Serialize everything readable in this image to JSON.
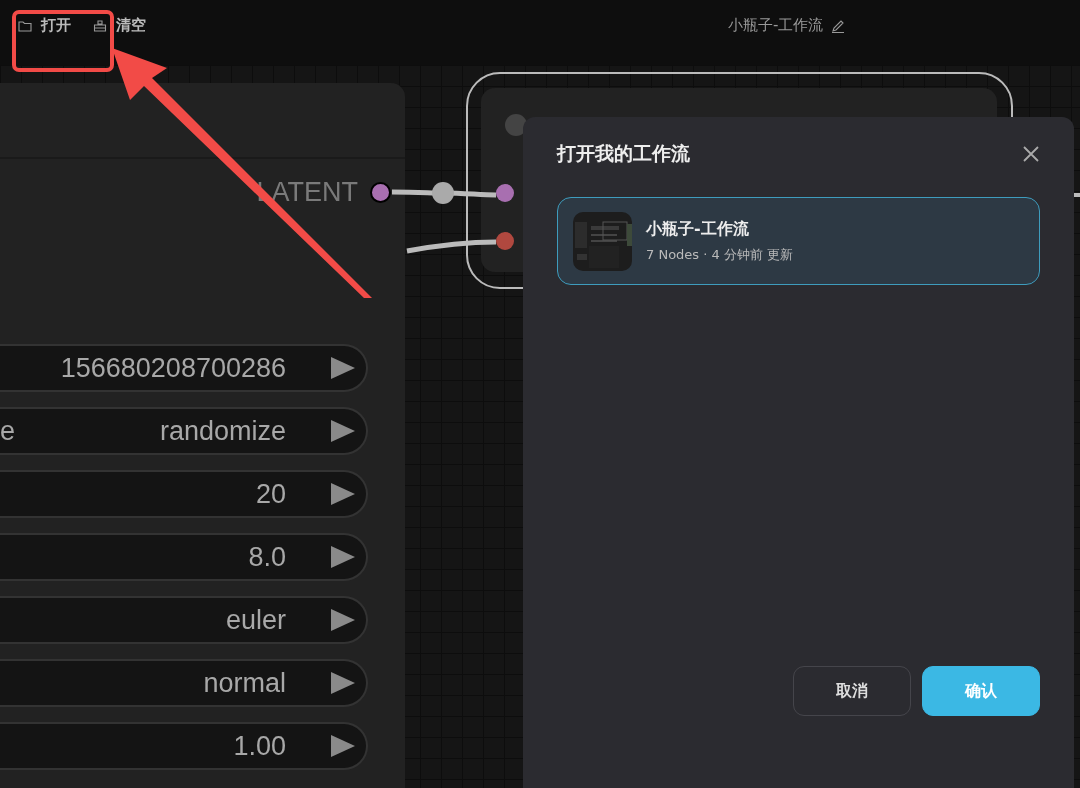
{
  "toolbar": {
    "buttons": [
      {
        "kind": "open",
        "label": "打开"
      },
      {
        "kind": "clear",
        "label": "清空"
      }
    ],
    "workflow_title": "小瓶子-工作流"
  },
  "sampler_node": {
    "output": "LATENT",
    "widgets": [
      {
        "value": "156680208700286"
      },
      {
        "label": "e",
        "value": "randomize"
      },
      {
        "value": "20"
      },
      {
        "value": "8.0"
      },
      {
        "value": "euler"
      },
      {
        "value": "normal"
      },
      {
        "value": "1.00"
      }
    ]
  },
  "decode_node": {
    "inputs": [
      {
        "color": "#a86fb0"
      },
      {
        "color": "#b0483f"
      }
    ]
  },
  "dialog": {
    "title": "打开我的工作流",
    "workflows": [
      {
        "name": "小瓶子-工作流",
        "meta": "7 Nodes · 4 分钟前 更新",
        "selected": true
      }
    ],
    "buttons": [
      {
        "kind": "secondary",
        "label": "取消"
      },
      {
        "kind": "primary",
        "label": "确认"
      }
    ]
  }
}
